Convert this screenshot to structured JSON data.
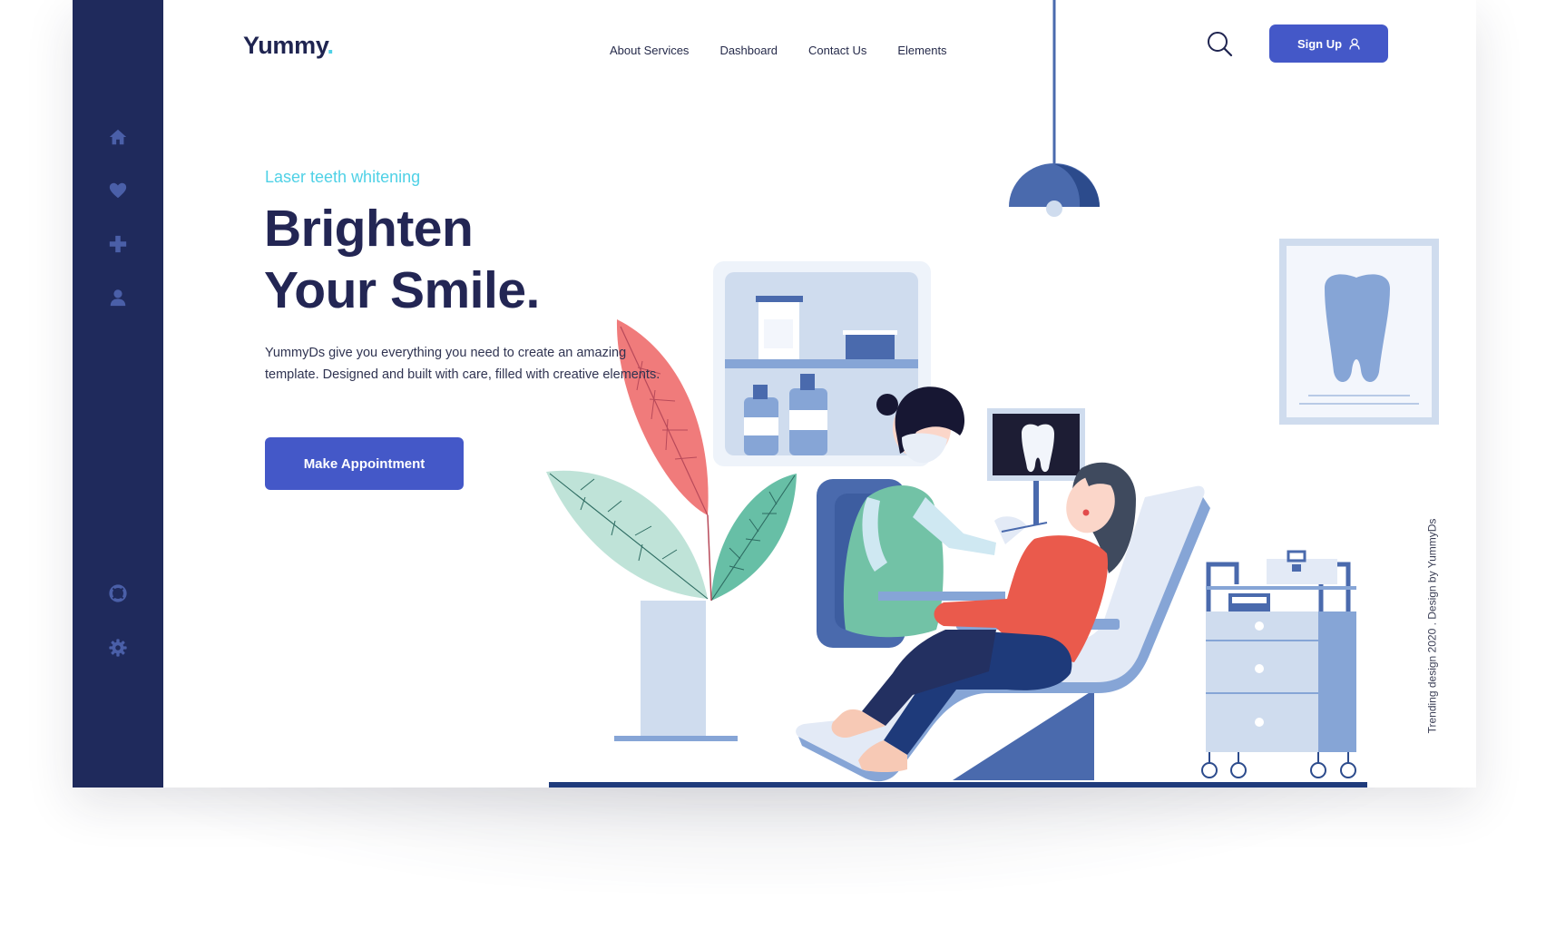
{
  "brand": {
    "name": "Yummy",
    "dot": "."
  },
  "nav": {
    "items": [
      {
        "label": "About Services"
      },
      {
        "label": "Dashboard"
      },
      {
        "label": "Contact Us"
      },
      {
        "label": "Elements"
      }
    ]
  },
  "header": {
    "signup_label": "Sign Up",
    "search_icon": "search-icon",
    "user_icon": "user-icon"
  },
  "sidebar": {
    "top_icons": [
      "home-icon",
      "heart-icon",
      "plus-icon",
      "user-icon"
    ],
    "bottom_icons": [
      "lifebuoy-icon",
      "gear-icon"
    ]
  },
  "hero": {
    "eyebrow": "Laser teeth whitening",
    "headline_line1": "Brighten",
    "headline_line2": "Your Smile.",
    "description_line1": "YummyDs give you everything you need to create an amazing",
    "description_line2": "template.  Designed and built with care, filled with creative elements.",
    "cta_label": "Make Appointment"
  },
  "footer": {
    "credit": "Trending design 2020 . Design by YummyDs"
  },
  "colors": {
    "sidebar": "#1f2a5c",
    "primary": "#4458c8",
    "accent": "#4fd1e6",
    "heading": "#232654",
    "illustration_blue": "#4a6aad",
    "illustration_light": "#cfdcee"
  }
}
